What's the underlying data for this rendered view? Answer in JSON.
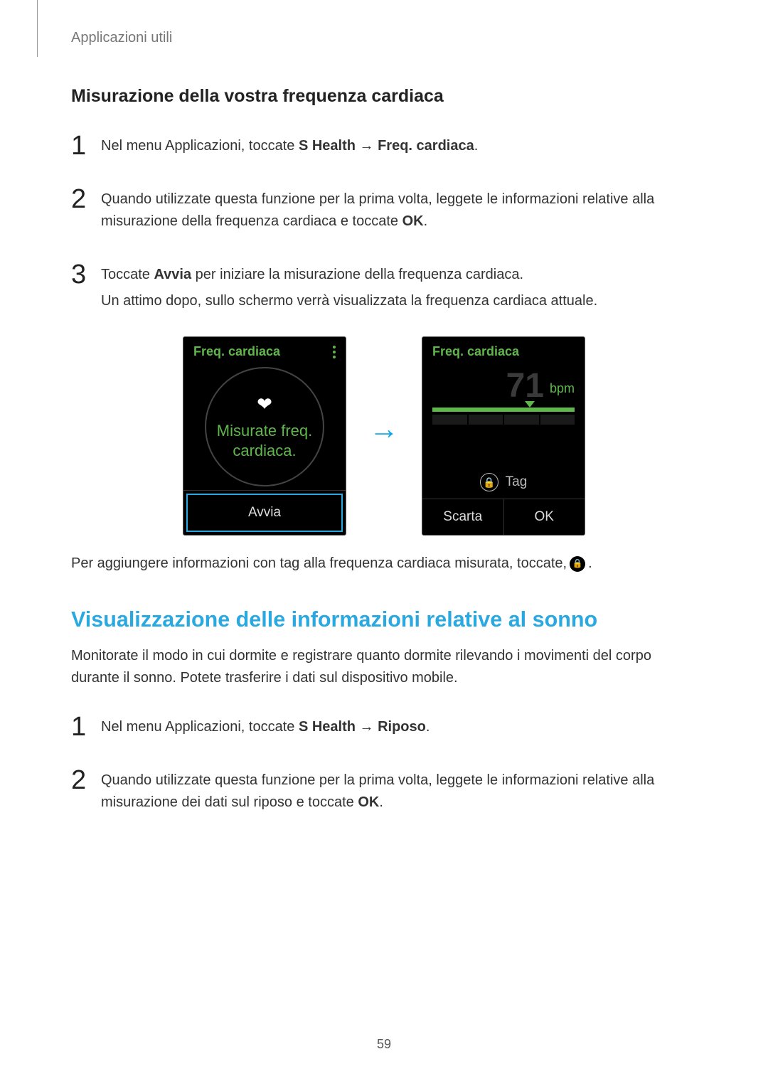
{
  "breadcrumb": "Applicazioni utili",
  "section1": {
    "heading": "Misurazione della vostra frequenza cardiaca",
    "step1_pre": "Nel menu Applicazioni, toccate ",
    "step1_b1": "S Health",
    "step1_arrow": " → ",
    "step1_b2": "Freq. cardiaca",
    "step1_post": ".",
    "step2_pre": "Quando utilizzate questa funzione per la prima volta, leggete le informazioni relative alla misurazione della frequenza cardiaca e toccate ",
    "step2_b": "OK",
    "step2_post": ".",
    "step3a_pre": "Toccate ",
    "step3a_b": "Avvia",
    "step3a_post": " per iniziare la misurazione della frequenza cardiaca.",
    "step3b": "Un attimo dopo, sullo schermo verrà visualizzata la frequenza cardiaca attuale."
  },
  "device_left": {
    "title": "Freq. cardiaca",
    "circle_line1": "Misurate freq.",
    "circle_line2": "cardiaca.",
    "button": "Avvia"
  },
  "device_right": {
    "title": "Freq. cardiaca",
    "bpm_value": "71",
    "bpm_label": "bpm",
    "tag_label": "Tag",
    "btn_left": "Scarta",
    "btn_right": "OK"
  },
  "after_shot": {
    "text": "Per aggiungere informazioni con tag alla frequenza cardiaca misurata, toccate, ",
    "post": "."
  },
  "section2": {
    "heading": "Visualizzazione delle informazioni relative al sonno",
    "intro": "Monitorate il modo in cui dormite e registrare quanto dormite rilevando i movimenti del corpo durante il sonno. Potete trasferire i dati sul dispositivo mobile.",
    "step1_pre": "Nel menu Applicazioni, toccate ",
    "step1_b1": "S Health",
    "step1_arrow": " → ",
    "step1_b2": "Riposo",
    "step1_post": ".",
    "step2_pre": "Quando utilizzate questa funzione per la prima volta, leggete le informazioni relative alla misurazione dei dati sul riposo e toccate ",
    "step2_b": "OK",
    "step2_post": "."
  },
  "nums": {
    "n1": "1",
    "n2": "2",
    "n3": "3"
  },
  "page_number": "59"
}
